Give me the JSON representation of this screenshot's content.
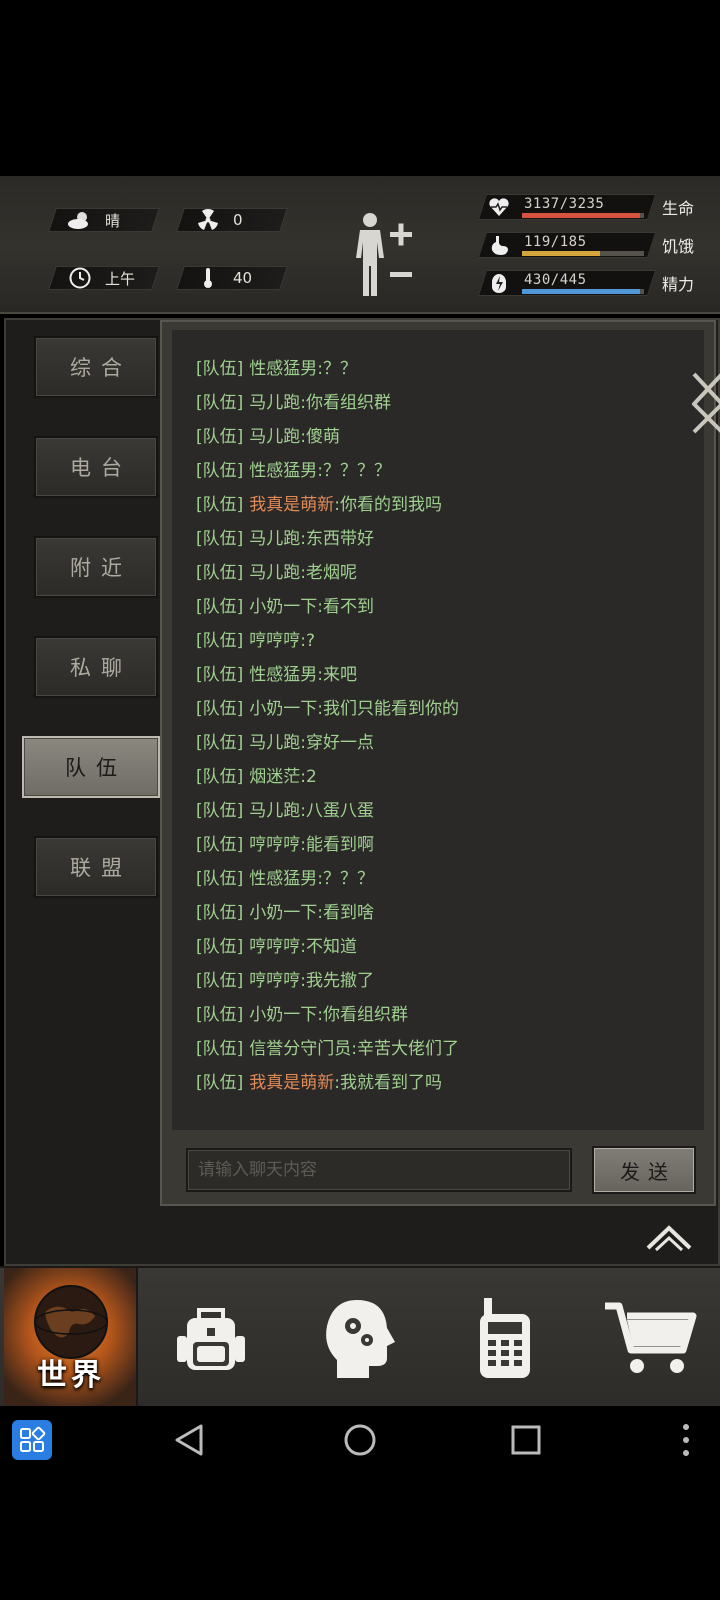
{
  "status": {
    "weather": "晴",
    "radiation": "0",
    "time_of_day": "上午",
    "temperature": "40"
  },
  "vitals": [
    {
      "label": "生命",
      "value": "3137/3235",
      "fill": 0.97,
      "color": "#d8533f",
      "icon": "heart-icon"
    },
    {
      "label": "饥饿",
      "value": "119/185",
      "fill": 0.64,
      "color": "#d4a53a",
      "icon": "stomach-icon"
    },
    {
      "label": "精力",
      "value": "430/445",
      "fill": 0.97,
      "color": "#4f97d6",
      "icon": "energy-icon"
    }
  ],
  "tabs": [
    {
      "label": "综合",
      "active": false
    },
    {
      "label": "电台",
      "active": false
    },
    {
      "label": "附近",
      "active": false
    },
    {
      "label": "私聊",
      "active": false
    },
    {
      "label": "队伍",
      "active": true
    },
    {
      "label": "联盟",
      "active": false
    }
  ],
  "chat": {
    "messages": [
      {
        "channel": "[队伍]",
        "sender": "性感猛男",
        "text": ":？？",
        "highlight": false
      },
      {
        "channel": "[队伍]",
        "sender": "马儿跑",
        "text": ":你看组织群",
        "highlight": false
      },
      {
        "channel": "[队伍]",
        "sender": "马儿跑",
        "text": ":傻萌",
        "highlight": false
      },
      {
        "channel": "[队伍]",
        "sender": "性感猛男",
        "text": ":？？？？",
        "highlight": false
      },
      {
        "channel": "[队伍]",
        "sender": "我真是萌新",
        "text": ":你看的到我吗",
        "highlight": true
      },
      {
        "channel": "[队伍]",
        "sender": "马儿跑",
        "text": ":东西带好",
        "highlight": false
      },
      {
        "channel": "[队伍]",
        "sender": "马儿跑",
        "text": ":老烟呢",
        "highlight": false
      },
      {
        "channel": "[队伍]",
        "sender": "小奶一下",
        "text": ":看不到",
        "highlight": false
      },
      {
        "channel": "[队伍]",
        "sender": "哼哼哼",
        "text": ":?",
        "highlight": false
      },
      {
        "channel": "[队伍]",
        "sender": "性感猛男",
        "text": ":来吧",
        "highlight": false
      },
      {
        "channel": "[队伍]",
        "sender": "小奶一下",
        "text": ":我们只能看到你的",
        "highlight": false
      },
      {
        "channel": "[队伍]",
        "sender": "马儿跑",
        "text": ":穿好一点",
        "highlight": false
      },
      {
        "channel": "[队伍]",
        "sender": "烟迷茫",
        "text": ":2",
        "highlight": false
      },
      {
        "channel": "[队伍]",
        "sender": "马儿跑",
        "text": ":八蛋八蛋",
        "highlight": false
      },
      {
        "channel": "[队伍]",
        "sender": "哼哼哼",
        "text": ":能看到啊",
        "highlight": false
      },
      {
        "channel": "[队伍]",
        "sender": "性感猛男",
        "text": ":？？？",
        "highlight": false
      },
      {
        "channel": "[队伍]",
        "sender": "小奶一下",
        "text": ":看到啥",
        "highlight": false
      },
      {
        "channel": "[队伍]",
        "sender": "哼哼哼",
        "text": ":不知道",
        "highlight": false
      },
      {
        "channel": "[队伍]",
        "sender": "哼哼哼",
        "text": ":我先撤了",
        "highlight": false
      },
      {
        "channel": "[队伍]",
        "sender": "小奶一下",
        "text": ":你看组织群",
        "highlight": false
      },
      {
        "channel": "[队伍]",
        "sender": "信誉分守门员",
        "text": ":辛苦大佬们了",
        "highlight": false
      },
      {
        "channel": "[队伍]",
        "sender": "我真是萌新",
        "text": ":我就看到了吗",
        "highlight": true
      }
    ],
    "input_placeholder": "请输入聊天内容",
    "send_label": "发送"
  },
  "nav": {
    "world_label": "世界",
    "items": [
      "globe-icon",
      "backpack-icon",
      "skills-head-icon",
      "radio-icon",
      "shop-cart-icon"
    ]
  },
  "colors": {
    "chat_text": "#9fd08f",
    "highlight_sender": "#e08a57",
    "accent": "#e8832a"
  }
}
